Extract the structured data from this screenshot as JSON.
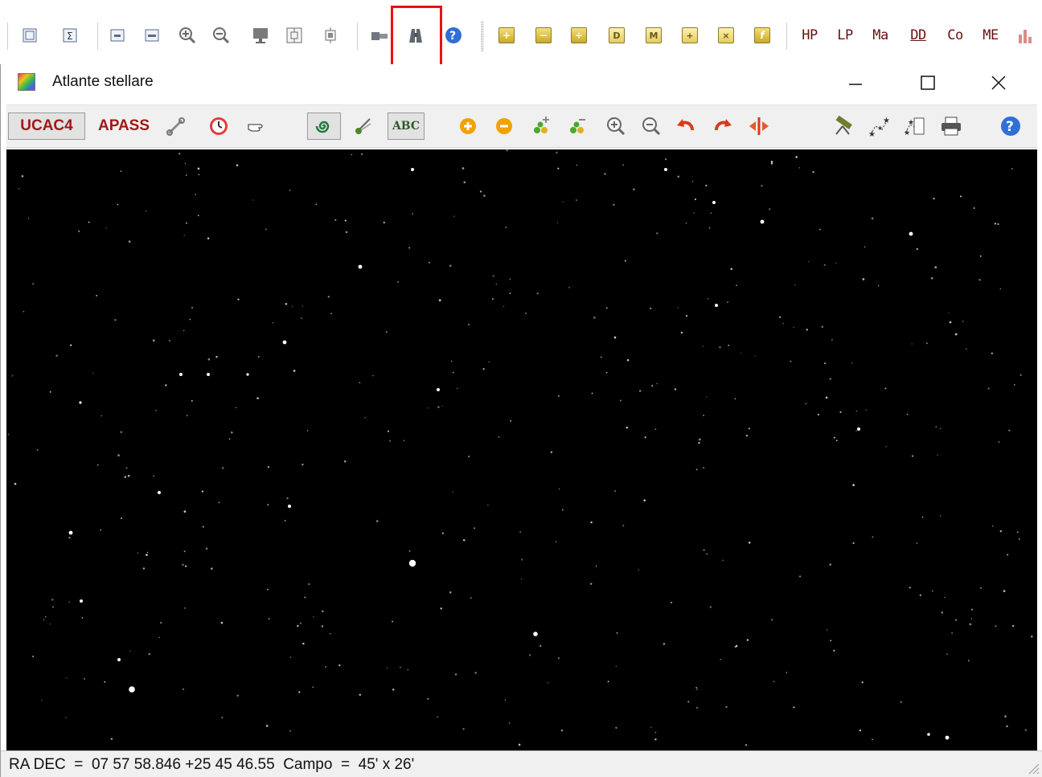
{
  "parent_toolbar": {
    "label_buttons": [
      "HP",
      "LP",
      "Ma",
      "DD",
      "Co",
      "ME"
    ],
    "tile_buttons": [
      "+",
      "−",
      "÷",
      "D",
      "M",
      "+",
      "×",
      "f"
    ]
  },
  "window": {
    "title": "Atlante stellare",
    "controls": {
      "minimize": "─",
      "maximize": "☐",
      "close": "✕"
    }
  },
  "atlas_toolbar": {
    "catalog_primary": "UCAC4",
    "catalog_secondary": "APASS",
    "labels_toggle": "ABC"
  },
  "status_bar": {
    "text": "RA DEC  =  07 57 58.846 +25 45 46.55  Campo  =  45' x 26'"
  },
  "colors": {
    "highlight": "#ee1111",
    "catalog_text": "#a01818",
    "sky": "#000000",
    "tile_gold": "#d9b838"
  }
}
